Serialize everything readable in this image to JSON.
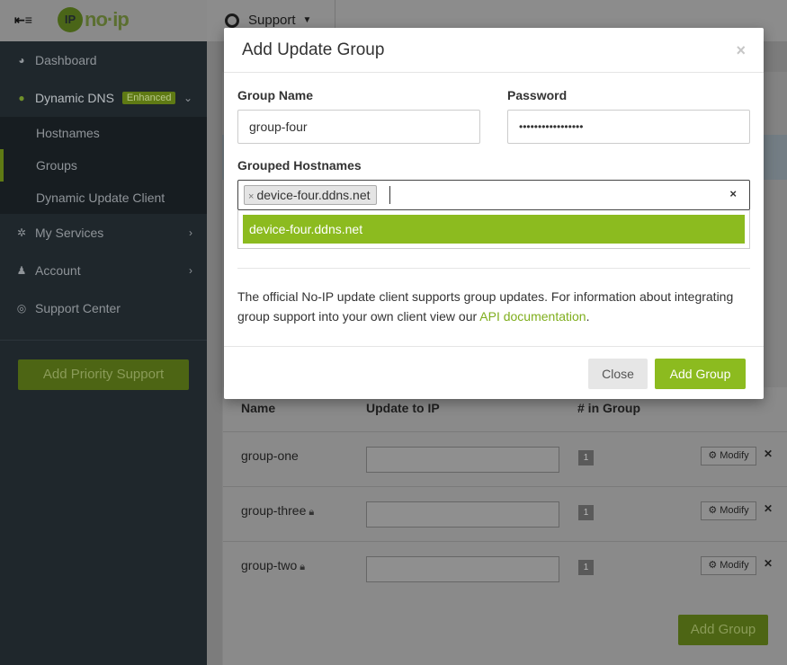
{
  "sidebar": {
    "logo_mark": "IP",
    "logo_text": "no·ip",
    "nav": {
      "dashboard": "Dashboard",
      "dynamic_dns": "Dynamic DNS",
      "enhanced_badge": "Enhanced",
      "my_services": "My Services",
      "account": "Account",
      "support_center": "Support Center"
    },
    "submenu": [
      "Hostnames",
      "Groups",
      "Dynamic Update Client"
    ],
    "priority_button": "Add Priority Support"
  },
  "topbar": {
    "support": "Support"
  },
  "groups_table": {
    "headers": {
      "name": "Name",
      "update_ip": "Update to IP",
      "in_group": "# in Group"
    },
    "rows": [
      {
        "name": "group-one",
        "count": "1",
        "modify": "Modify"
      },
      {
        "name": "group-three",
        "count": "1",
        "modify": "Modify"
      },
      {
        "name": "group-two",
        "count": "1",
        "modify": "Modify"
      }
    ],
    "add_button": "Add Group"
  },
  "modal": {
    "title": "Add Update Group",
    "close_glyph": "×",
    "group_name_label": "Group Name",
    "group_name_value": "group-four",
    "password_label": "Password",
    "password_value": "•••••••••••••••••",
    "hostnames_label": "Grouped Hostnames",
    "selected_tag": "device-four.ddns.net",
    "dropdown_option": "device-four.ddns.net",
    "info_text": "The official No-IP update client supports group updates. For information about integrating group support into your own client view our",
    "info_link": "API documentation",
    "info_end": ".",
    "close_button": "Close",
    "add_button": "Add Group"
  },
  "colors": {
    "brand_green": "#8cbb1f",
    "link_green": "#7fae1d",
    "sidebar_bg": "#1f272c"
  }
}
